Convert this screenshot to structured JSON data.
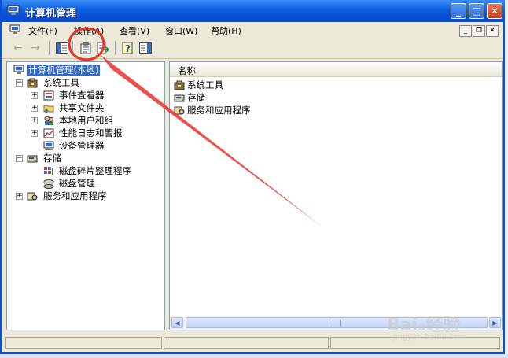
{
  "window": {
    "title": "计算机管理"
  },
  "menubar": {
    "items": [
      "文件(F)",
      "操作(A)",
      "查看(V)",
      "窗口(W)",
      "帮助(H)"
    ]
  },
  "tree": {
    "root": "计算机管理(本地)",
    "system_tools": "系统工具",
    "event_viewer": "事件查看器",
    "shared_folders": "共享文件夹",
    "local_users": "本地用户和组",
    "perf_logs": "性能日志和警报",
    "device_manager": "设备管理器",
    "storage": "存储",
    "defrag": "磁盘碎片整理程序",
    "disk_mgmt": "磁盘管理",
    "services_apps": "服务和应用程序"
  },
  "list": {
    "header_name": "名称",
    "rows": [
      "系统工具",
      "存储",
      "服务和应用程序"
    ]
  },
  "watermark": {
    "brand": "Bai",
    "brand_suffix": "经验",
    "url": "jingyan.baidu.com"
  },
  "colors": {
    "titlebar": "#0a4fd6",
    "selection": "#316ac5",
    "annotation": "#e8322a"
  }
}
